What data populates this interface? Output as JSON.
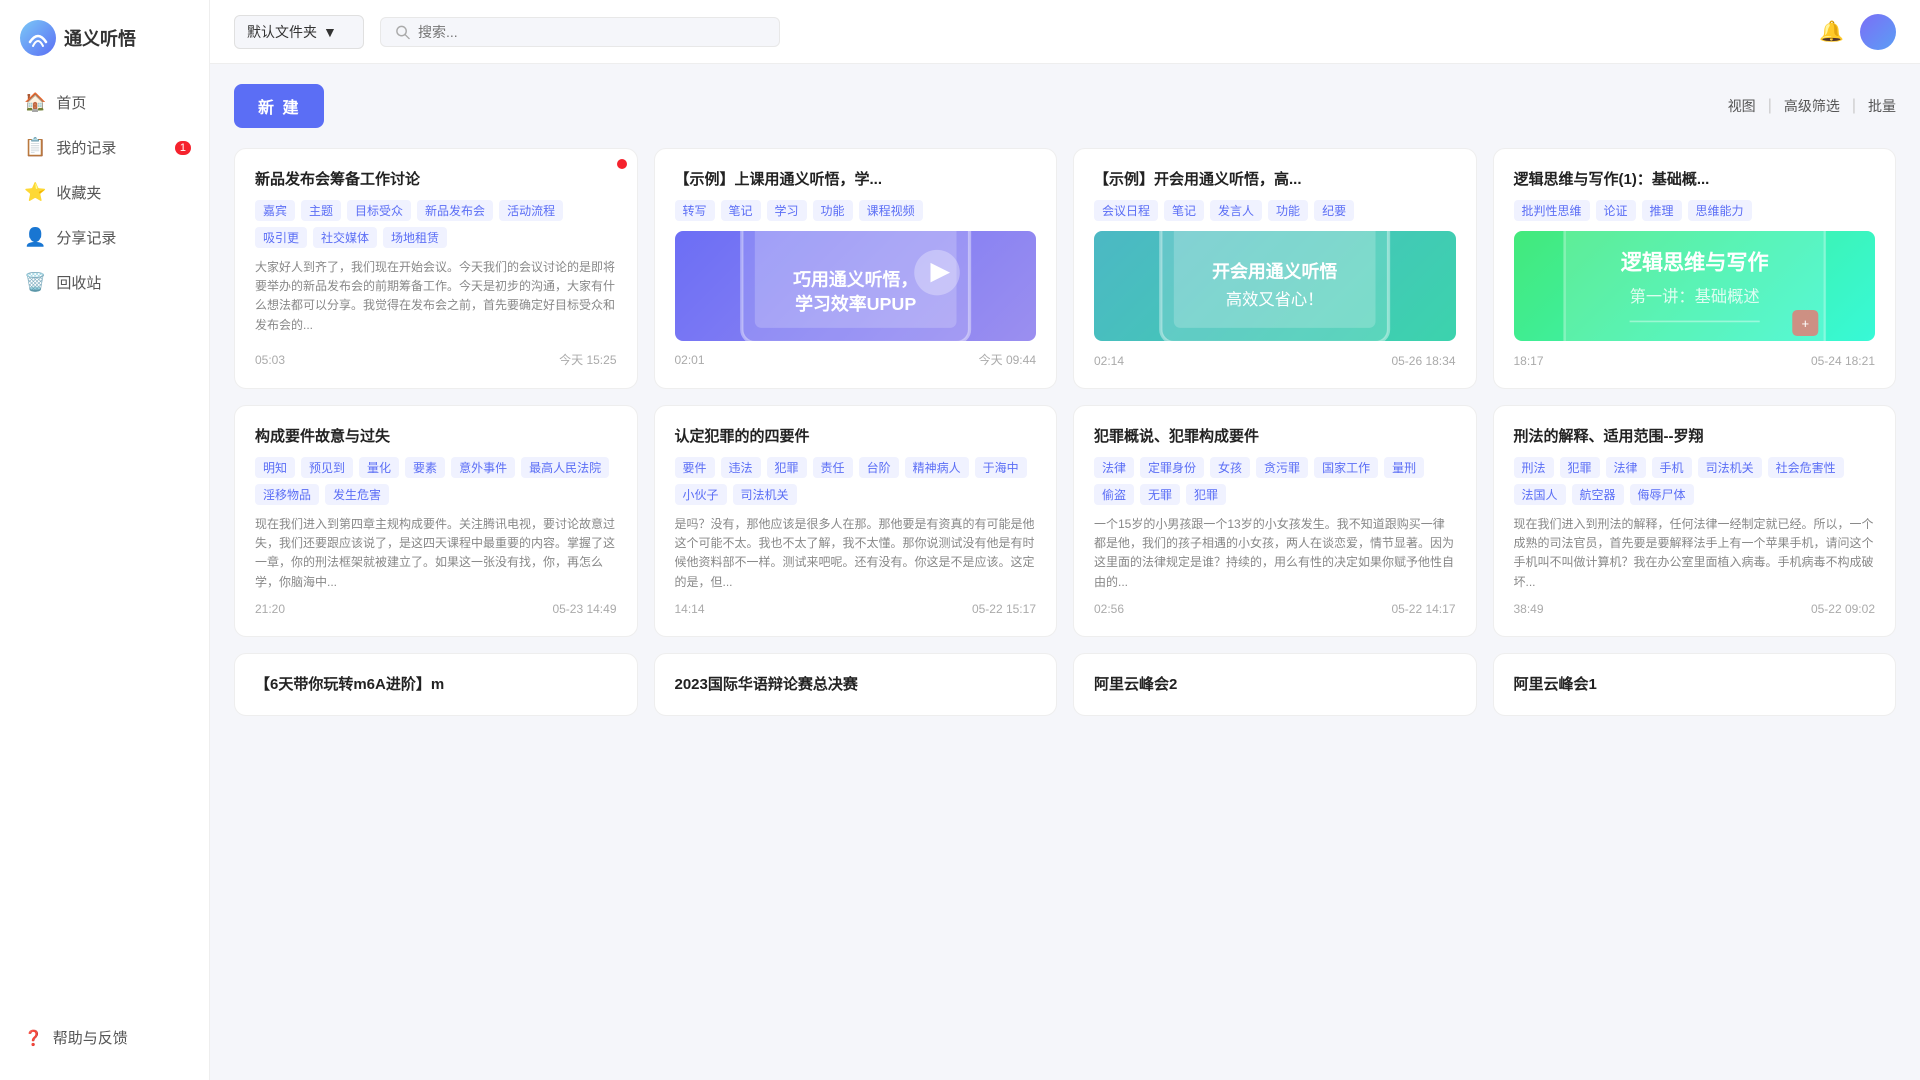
{
  "app": {
    "name": "通义听悟",
    "logo_alt": "logo"
  },
  "sidebar": {
    "nav_items": [
      {
        "id": "home",
        "label": "首页",
        "icon": "🏠",
        "active": false
      },
      {
        "id": "my-records",
        "label": "我的记录",
        "icon": "📋",
        "badge": "1",
        "active": false
      },
      {
        "id": "favorites",
        "label": "收藏夹",
        "icon": "⭐",
        "active": false
      },
      {
        "id": "shared",
        "label": "分享记录",
        "icon": "👤",
        "active": false
      },
      {
        "id": "trash",
        "label": "回收站",
        "icon": "🗑️",
        "active": false
      }
    ],
    "help": {
      "label": "帮助与反馈",
      "icon": "❓"
    }
  },
  "header": {
    "folder_label": "默认文件夹",
    "search_placeholder": "搜索...",
    "dropdown_icon": "▼"
  },
  "toolbar": {
    "new_label": "新 建",
    "view_label": "视图",
    "filter_label": "高级筛选",
    "batch_label": "批量"
  },
  "cards": [
    {
      "id": "card-1",
      "title": "新品发布会筹备工作讨论",
      "tags": [
        "嘉宾",
        "主题",
        "目标受众",
        "新品发布会",
        "活动流程",
        "吸引更",
        "社交媒体",
        "场地租赁"
      ],
      "has_image": false,
      "excerpt": "大家好人到齐了，我们现在开始会议。今天我们的会议讨论的是即将要举办的新品发布会的前期筹备工作。今天是初步的沟通，大家有什么想法都可以分享。我觉得在发布会之前，首先要确定好目标受众和发布会的...",
      "duration": "05:03",
      "date": "今天 15:25",
      "has_dot": true
    },
    {
      "id": "card-2",
      "title": "【示例】上课用通义听悟，学...",
      "tags": [
        "转写",
        "笔记",
        "学习",
        "功能",
        "课程视频"
      ],
      "has_image": true,
      "image_type": "laptop-purple",
      "image_text": "巧用通义听悟，学习效率UPUP",
      "excerpt": "",
      "duration": "02:01",
      "date": "今天 09:44",
      "has_dot": false
    },
    {
      "id": "card-3",
      "title": "【示例】开会用通义听悟，高...",
      "tags": [
        "会议日程",
        "笔记",
        "发言人",
        "功能",
        "纪要"
      ],
      "has_image": true,
      "image_type": "laptop-teal",
      "image_text": "开会用通义听悟 高效又省心！",
      "excerpt": "",
      "duration": "02:14",
      "date": "05-26 18:34",
      "has_dot": false
    },
    {
      "id": "card-4",
      "title": "逻辑思维与写作(1)：基础概...",
      "tags": [
        "批判性思维",
        "论证",
        "推理",
        "思维能力"
      ],
      "has_image": true,
      "image_type": "gradient-green",
      "image_text": "逻辑思维与写作",
      "excerpt": "",
      "duration": "18:17",
      "date": "05-24 18:21",
      "has_dot": false
    },
    {
      "id": "card-5",
      "title": "构成要件故意与过失",
      "tags": [
        "明知",
        "预见到",
        "量化",
        "要素",
        "意外事件",
        "最高人民法院",
        "淫移物品",
        "发生危害"
      ],
      "has_image": false,
      "excerpt": "现在我们进入到第四章主规构成要件。关注腾讯电视，要讨论故意过失，我们还要跟应该说了，是这四天课程中最重要的内容。掌握了这一章，你的刑法框架就被建立了。如果这一张没有找，你，再怎么学，你脑海中...",
      "duration": "21:20",
      "date": "05-23 14:49",
      "has_dot": false
    },
    {
      "id": "card-6",
      "title": "认定犯罪的的四要件",
      "tags": [
        "要件",
        "违法",
        "犯罪",
        "责任",
        "台阶",
        "精神病人",
        "于海中",
        "小伙子",
        "司法机关"
      ],
      "has_image": false,
      "excerpt": "是吗？没有，那他应该是很多人在那。那他要是有资真的有可能是他这个可能不太。我也不太了解，我不太懂。那你说测试没有他是有时候他资料部不一样。测试来吧呢。还有没有。你这是不是应该。这定的是，但...",
      "duration": "14:14",
      "date": "05-22 15:17",
      "has_dot": false
    },
    {
      "id": "card-7",
      "title": "犯罪概说、犯罪构成要件",
      "tags": [
        "法律",
        "定罪身份",
        "女孩",
        "贪污罪",
        "国家工作",
        "量刑",
        "偷盗",
        "无罪",
        "犯罪"
      ],
      "has_image": false,
      "excerpt": "一个15岁的小男孩跟一个13岁的小女孩发生。我不知道跟购买一律都是他，我们的孩子相遇的小女孩，两人在谈恋爱，情节显著。因为这里面的法律规定是谁？持续的，用么有性的决定如果你赋予他性自由的...",
      "duration": "02:56",
      "date": "05-22 14:17",
      "has_dot": false
    },
    {
      "id": "card-8",
      "title": "刑法的解释、适用范围--罗翔",
      "tags": [
        "刑法",
        "犯罪",
        "法律",
        "手机",
        "司法机关",
        "社会危害性",
        "法国人",
        "航空器",
        "侮辱尸体"
      ],
      "has_image": false,
      "excerpt": "现在我们进入到刑法的解释，任何法律一经制定就已经。所以，一个成熟的司法官员，首先要是要解释法手上有一个苹果手机，请问这个手机叫不叫做计算机？我在办公室里面植入病毒。手机病毒不构成破坏...",
      "duration": "38:49",
      "date": "05-22 09:02",
      "has_dot": false
    },
    {
      "id": "card-9",
      "title": "【6天带你玩转m6A进阶】m",
      "tags": [],
      "has_image": false,
      "excerpt": "",
      "duration": "",
      "date": "",
      "has_dot": false
    },
    {
      "id": "card-10",
      "title": "2023国际华语辩论赛总决赛",
      "tags": [],
      "has_image": false,
      "excerpt": "",
      "duration": "",
      "date": "",
      "has_dot": false
    },
    {
      "id": "card-11",
      "title": "阿里云峰会2",
      "tags": [],
      "has_image": false,
      "excerpt": "",
      "duration": "",
      "date": "",
      "has_dot": false
    },
    {
      "id": "card-12",
      "title": "阿里云峰会1",
      "tags": [],
      "has_image": false,
      "excerpt": "",
      "duration": "",
      "date": "",
      "has_dot": false
    }
  ]
}
